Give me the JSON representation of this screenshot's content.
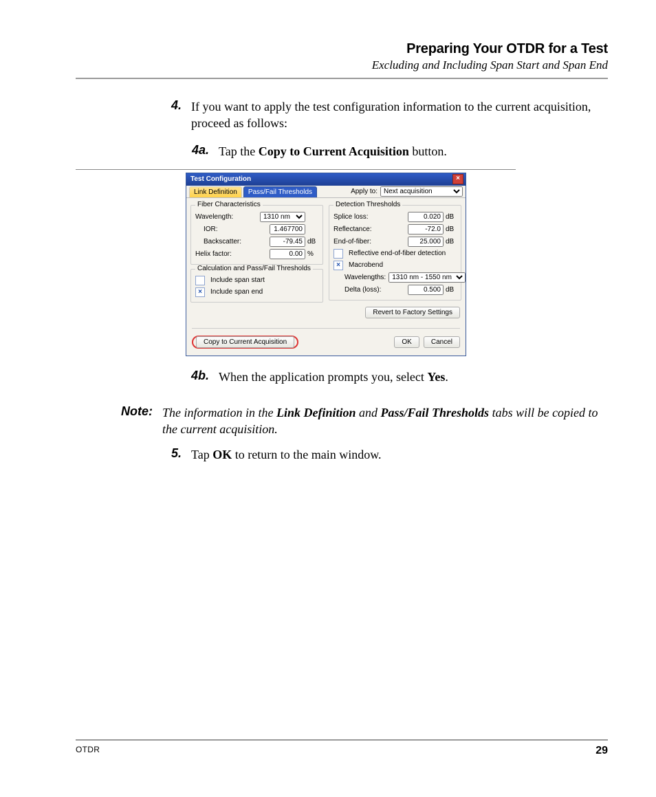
{
  "header": {
    "title": "Preparing Your OTDR for a Test",
    "subtitle": "Excluding and Including Span Start and Span End"
  },
  "step4": {
    "num": "4.",
    "text": "If you want to apply the test configuration information to the current acquisition, proceed as follows:"
  },
  "step4a": {
    "num": "4a.",
    "pre": "Tap the ",
    "bold": "Copy to Current Acquisition",
    "post": " button."
  },
  "step4b": {
    "num": "4b.",
    "pre": "When the application prompts you, select ",
    "bold": "Yes",
    "post": "."
  },
  "note": {
    "label": "Note:",
    "pre": "The information in the ",
    "b1": "Link Definition",
    "mid": " and ",
    "b2": "Pass/Fail Thresholds",
    "post": " tabs will be copied to the current acquisition."
  },
  "step5": {
    "num": "5.",
    "pre": "Tap ",
    "bold": "OK",
    "post": " to return to the main window."
  },
  "footer": {
    "left": "OTDR",
    "right": "29"
  },
  "dialog": {
    "title": "Test Configuration",
    "close_glyph": "×",
    "tabs": {
      "link_def": "Link Definition",
      "pf_thresh": "Pass/Fail Thresholds"
    },
    "apply_to_label": "Apply to:",
    "apply_to_value": "Next acquisition",
    "fiber_group": "Fiber Characteristics",
    "calc_group": "Calculation and Pass/Fail Thresholds",
    "det_group": "Detection Thresholds",
    "wavelength_label": "Wavelength:",
    "wavelength_value": "1310 nm",
    "ior_label": "IOR:",
    "ior_value": "1.467700",
    "backscatter_label": "Backscatter:",
    "backscatter_value": "-79.45",
    "helix_label": "Helix factor:",
    "helix_value": "0.00",
    "unit_db": "dB",
    "unit_pct": "%",
    "include_span_start": "Include span start",
    "include_span_end": "Include span end",
    "splice_loss_label": "Splice loss:",
    "splice_loss_value": "0.020",
    "reflectance_label": "Reflectance:",
    "reflectance_value": "-72.0",
    "eof_label": "End-of-fiber:",
    "eof_value": "25.000",
    "reflective_eof": "Reflective end-of-fiber detection",
    "macrobend": "Macrobend",
    "mw_label": "Wavelengths:",
    "mw_value": "1310 nm - 1550 nm",
    "delta_label": "Delta (loss):",
    "delta_value": "0.500",
    "revert_btn": "Revert to Factory Settings",
    "copy_btn": "Copy to Current Acquisition",
    "ok_btn": "OK",
    "cancel_btn": "Cancel"
  }
}
